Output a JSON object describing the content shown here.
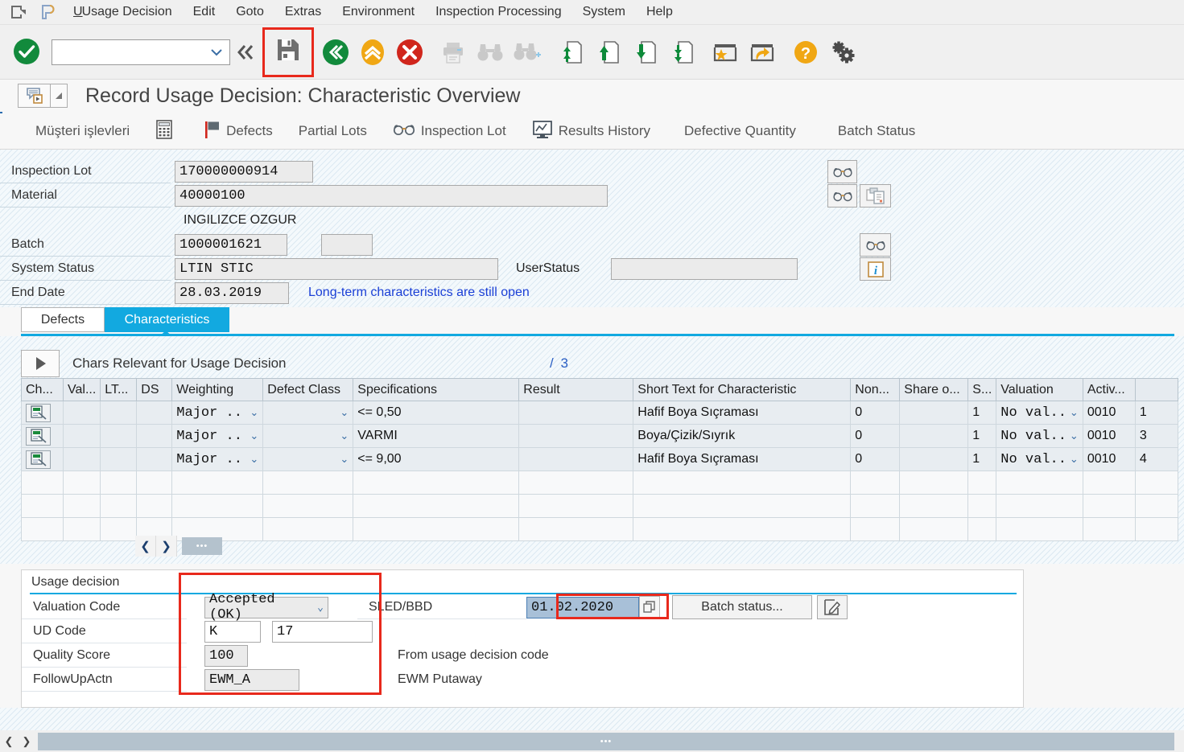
{
  "window": {
    "title": "Record Usage Decision: Characteristic Overview",
    "system_icon": "exit-arrow-icon",
    "pin_icon": "paragraph-icon"
  },
  "menubar": {
    "items": [
      {
        "label": "Usage Decision",
        "accel": "U"
      },
      {
        "label": "Edit",
        "accel": "E"
      },
      {
        "label": "Goto",
        "accel": "G"
      },
      {
        "label": "Extras",
        "accel": "a"
      },
      {
        "label": "Environment",
        "accel": "v"
      },
      {
        "label": "Inspection Processing",
        "accel": ""
      },
      {
        "label": "System",
        "accel": ""
      },
      {
        "label": "Help",
        "accel": "H"
      }
    ]
  },
  "toolbar": {
    "command_field_value": "",
    "command_field_placeholder": "",
    "buttons": [
      {
        "name": "enter-ok-icon",
        "title": "Enter"
      },
      {
        "name": "command-dropdown-icon",
        "title": "Command field"
      },
      {
        "name": "collapse-double-chevron-icon",
        "title": "Collapse"
      },
      {
        "name": "save-icon",
        "title": "Save",
        "highlighted": true
      },
      {
        "name": "back-green-icon",
        "title": "Back"
      },
      {
        "name": "exit-yellow-icon",
        "title": "Exit"
      },
      {
        "name": "cancel-red-icon",
        "title": "Cancel"
      },
      {
        "name": "print-icon",
        "title": "Print",
        "disabled": true
      },
      {
        "name": "find-icon",
        "title": "Find",
        "disabled": true
      },
      {
        "name": "find-next-icon",
        "title": "Find Next",
        "disabled": true
      },
      {
        "name": "first-page-icon",
        "title": "First page"
      },
      {
        "name": "previous-page-icon",
        "title": "Previous page"
      },
      {
        "name": "next-page-icon",
        "title": "Next page"
      },
      {
        "name": "last-page-icon",
        "title": "Last page"
      },
      {
        "name": "create-session-icon",
        "title": "Create session"
      },
      {
        "name": "create-shortcut-icon",
        "title": "Create shortcut"
      },
      {
        "name": "help-icon",
        "title": "Help"
      },
      {
        "name": "customize-local-layout-icon",
        "title": "Customize local layout"
      }
    ]
  },
  "apptoolbar": {
    "items": [
      {
        "label": "Müşteri işlevleri",
        "icon": ""
      },
      {
        "label": "",
        "icon": "calculator-icon"
      },
      {
        "label": "Defects",
        "icon": "flag-icon"
      },
      {
        "label": "Partial Lots",
        "icon": ""
      },
      {
        "label": "Inspection Lot",
        "icon": "glasses-icon"
      },
      {
        "label": "Results History",
        "icon": "monitor-chart-icon"
      },
      {
        "label": "Defective Quantity",
        "icon": ""
      },
      {
        "label": "Batch Status",
        "icon": ""
      }
    ]
  },
  "header": {
    "inspection_lot_label": "Inspection Lot",
    "inspection_lot_value": "170000000914",
    "material_label": "Material",
    "material_value": "40000100",
    "material_desc": "INGILIZCE OZGUR",
    "batch_label": "Batch",
    "batch_value": "1000001621",
    "batch_extra_value": "",
    "system_status_label": "System Status",
    "system_status_value": "LTIN STIC",
    "user_status_label": "UserStatus",
    "user_status_value": "",
    "end_date_label": "End Date",
    "end_date_value": "28.03.2019",
    "warning_text": "Long-term characteristics are still open"
  },
  "tabs": {
    "items": [
      {
        "label": "Defects",
        "active": false
      },
      {
        "label": "Characteristics",
        "active": true
      }
    ]
  },
  "grid": {
    "title": "Chars Relevant for Usage Decision",
    "count_separator": "/",
    "count_value": "3",
    "expand_icon": "play-triangle-icon",
    "columns": [
      "Ch...",
      "Val...",
      "LT...",
      "DS",
      "Weighting",
      "Defect Class",
      "Specifications",
      "Result",
      "Short Text for Characteristic",
      "Non...",
      "Share o...",
      "S...",
      "Valuation",
      "Activ...",
      ""
    ],
    "rows": [
      {
        "char_icon": "characteristic-icon",
        "val": "",
        "lt": "",
        "ds": "",
        "weighting": "Major  ..",
        "defect_class": "",
        "specifications": "<=  0,50",
        "result": "",
        "short_text": "Hafif Boya Sıçraması",
        "non": "0",
        "share": "",
        "s": "1",
        "valuation": "No val..",
        "activity": "0010",
        "last": "1"
      },
      {
        "char_icon": "characteristic-icon",
        "val": "",
        "lt": "",
        "ds": "",
        "weighting": "Major  ..",
        "defect_class": "",
        "specifications": "VARMI",
        "result": "",
        "short_text": "Boya/Çizik/Sıyrık",
        "non": "0",
        "share": "",
        "s": "1",
        "valuation": "No val..",
        "activity": "0010",
        "last": "3"
      },
      {
        "char_icon": "characteristic-icon",
        "val": "",
        "lt": "",
        "ds": "",
        "weighting": "Major  ..",
        "defect_class": "",
        "specifications": "<=  9,00",
        "result": "",
        "short_text": "Hafif Boya Sıçraması",
        "non": "0",
        "share": "",
        "s": "1",
        "valuation": "No val..",
        "activity": "0010",
        "last": "4"
      }
    ],
    "empty_row_count": 3,
    "scroll_left_icon": "chevron-left-icon",
    "scroll_right_icon": "chevron-right-icon"
  },
  "usage_decision": {
    "panel_title": "Usage decision",
    "valuation_code_label": "Valuation Code",
    "valuation_code_value": "Accepted (OK)",
    "ud_code_label": "UD Code",
    "ud_code_value": "K",
    "ud_code_value2": "17",
    "quality_score_label": "Quality Score",
    "quality_score_value": "100",
    "followup_label": "FollowUpActn",
    "followup_value": "EWM_A",
    "sled_label": "SLED/BBD",
    "sled_value": "01.02.2020",
    "sled_picker_icon": "value-help-icon",
    "batch_status_button": "Batch status...",
    "batch_status_edit_icon": "edit-pencil-icon",
    "from_ud_code_text": "From usage decision code",
    "ewm_putaway_text": "EWM Putaway"
  },
  "colors": {
    "accent_blue": "#12a9e0",
    "highlight_red": "#e8291c",
    "link_blue": "#1a3fd6",
    "selection_blue": "#a8c0d8",
    "sap_green": "#128a3c",
    "sap_yellow": "#f0a714"
  },
  "statusbar": {
    "scroll_thumb": "•••"
  }
}
